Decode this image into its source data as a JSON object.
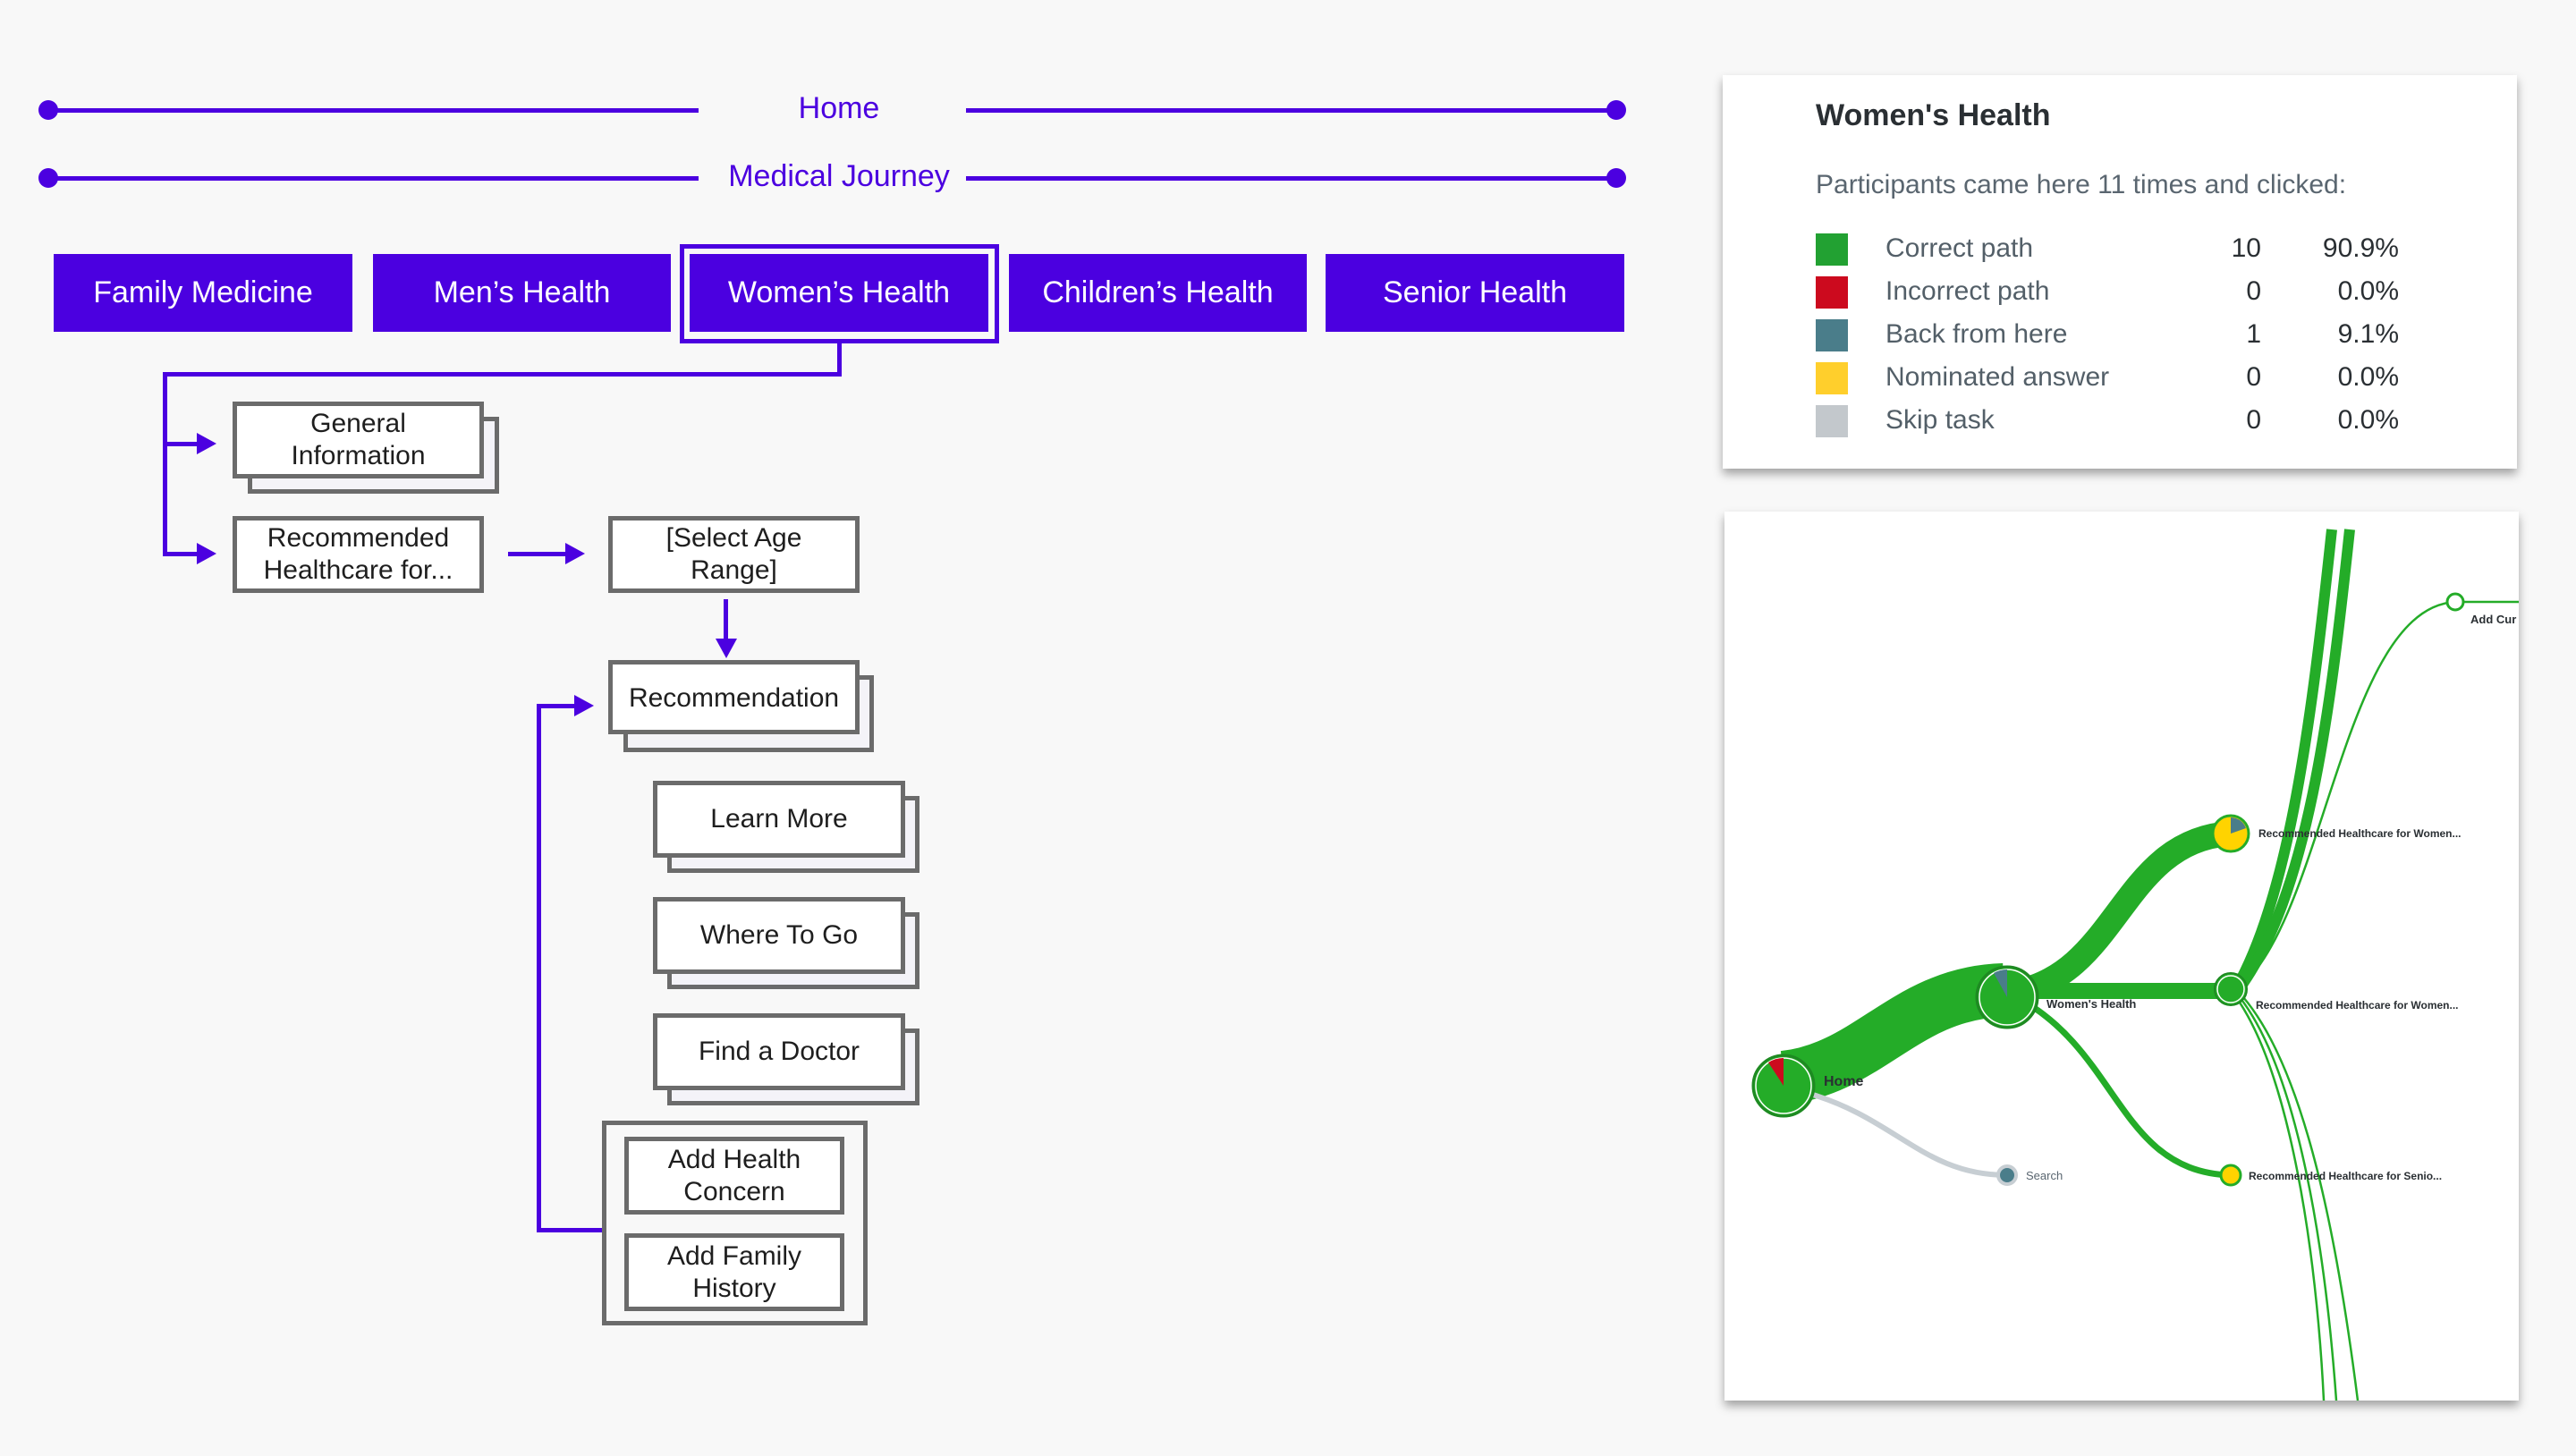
{
  "breadcrumbs": [
    {
      "label": "Home"
    },
    {
      "label": "Medical Journey"
    }
  ],
  "nav": {
    "items": [
      {
        "label": "Family Medicine"
      },
      {
        "label": "Men’s Health"
      },
      {
        "label": "Women’s Health",
        "selected": true
      },
      {
        "label": "Children’s Health"
      },
      {
        "label": "Senior Health"
      }
    ]
  },
  "flow": {
    "general_info": "General Information",
    "recommended": "Recommended Healthcare for...",
    "select_age": "[Select Age Range]",
    "recommendation": "Recommendation",
    "learn_more": "Learn More",
    "where_to_go": "Where To Go",
    "find_doctor": "Find a Doctor",
    "add_health_concern": "Add Health Concern",
    "add_family_history": "Add Family History"
  },
  "stats": {
    "title": "Women's Health",
    "subtitle": "Participants came here 11 times and clicked:",
    "rows": [
      {
        "label": "Correct path",
        "count": "10",
        "pct": "90.9%",
        "color": "#22a132"
      },
      {
        "label": "Incorrect path",
        "count": "0",
        "pct": "0.0%",
        "color": "#cc0a1e"
      },
      {
        "label": "Back from here",
        "count": "1",
        "pct": "9.1%",
        "color": "#4a7d8a"
      },
      {
        "label": "Nominated answer",
        "count": "0",
        "pct": "0.0%",
        "color": "#ffcf2c"
      },
      {
        "label": "Skip task",
        "count": "0",
        "pct": "0.0%",
        "color": "#c3c8cc"
      }
    ]
  },
  "pietree": {
    "nodes": {
      "home": "Home",
      "womens_health": "Women's Health",
      "search": "Search",
      "rec_women_1": "Recommended Healthcare for Women...",
      "rec_women_2": "Recommended Healthcare for Women...",
      "rec_senior": "Recommended Healthcare for Senio...",
      "add_cur": "Add Cur"
    }
  },
  "colors": {
    "brand": "#4b00e0",
    "correct": "#22a132",
    "incorrect": "#cc0a1e",
    "back": "#4a7d8a",
    "nominated": "#ffcf2c",
    "skip": "#c3c8cc"
  }
}
